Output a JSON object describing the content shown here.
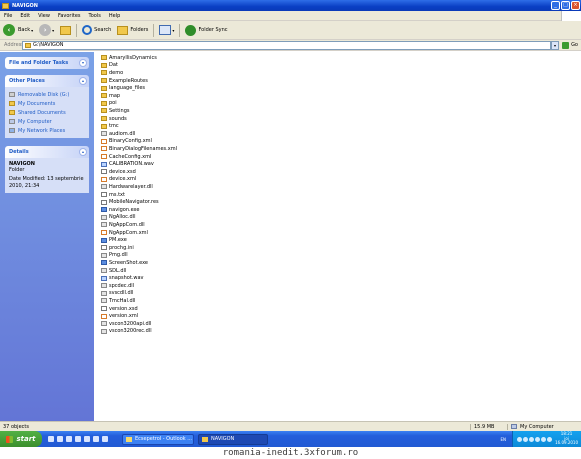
{
  "window": {
    "title": "NAVIGON"
  },
  "menu": [
    "File",
    "Edit",
    "View",
    "Favorites",
    "Tools",
    "Help"
  ],
  "toolbar": {
    "back": "Back",
    "search": "Search",
    "folders": "Folders",
    "folder_sync": "Folder Sync"
  },
  "address": {
    "label": "Address",
    "value": "G:\\NAVIGON",
    "go": "Go"
  },
  "tasks": {
    "file_folder": {
      "title": "File and Folder Tasks"
    },
    "other_places": {
      "title": "Other Places",
      "items": [
        "Removable Disk (G:)",
        "My Documents",
        "Shared Documents",
        "My Computer",
        "My Network Places"
      ]
    },
    "details": {
      "title": "Details",
      "name": "NAVIGON",
      "type": "Folder",
      "modified": "Date Modified: 13 septembrie 2010, 21:34"
    }
  },
  "files": [
    {
      "name": "AmaryllisDynamics",
      "kind": "folder"
    },
    {
      "name": "Dat",
      "kind": "folder"
    },
    {
      "name": "demo",
      "kind": "folder"
    },
    {
      "name": "ExampleRoutes",
      "kind": "folder"
    },
    {
      "name": "language_files",
      "kind": "folder"
    },
    {
      "name": "map",
      "kind": "folder"
    },
    {
      "name": "poi",
      "kind": "folder"
    },
    {
      "name": "Settings",
      "kind": "folder"
    },
    {
      "name": "sounds",
      "kind": "folder"
    },
    {
      "name": "tmc",
      "kind": "folder"
    },
    {
      "name": "audiom.dll",
      "kind": "dll"
    },
    {
      "name": "BinaryConfig.xml",
      "kind": "xml"
    },
    {
      "name": "BinaryDialogFilenames.xml",
      "kind": "xml"
    },
    {
      "name": "CacheConfig.xml",
      "kind": "xml"
    },
    {
      "name": "CALIBRATION.wav",
      "kind": "wav"
    },
    {
      "name": "device.xsd",
      "kind": "txt"
    },
    {
      "name": "device.xml",
      "kind": "xml"
    },
    {
      "name": "Hardwarelayer.dll",
      "kind": "dll"
    },
    {
      "name": "ms.txt",
      "kind": "txt"
    },
    {
      "name": "MobileNavigator.res",
      "kind": "txt"
    },
    {
      "name": "navigon.exe",
      "kind": "exe"
    },
    {
      "name": "NgAlloc.dll",
      "kind": "dll"
    },
    {
      "name": "NgAppCom.dll",
      "kind": "dll"
    },
    {
      "name": "NgAppCom.xml",
      "kind": "xml"
    },
    {
      "name": "PM.exe",
      "kind": "exe"
    },
    {
      "name": "prochg.ini",
      "kind": "txt"
    },
    {
      "name": "Pmg.dll",
      "kind": "dll"
    },
    {
      "name": "ScreenShot.exe",
      "kind": "exe"
    },
    {
      "name": "SDL.dll",
      "kind": "dll"
    },
    {
      "name": "snapshot.wav",
      "kind": "wav"
    },
    {
      "name": "spcdec.dll",
      "kind": "dll"
    },
    {
      "name": "svscdll.dll",
      "kind": "dll"
    },
    {
      "name": "TmcHal.dll",
      "kind": "dll"
    },
    {
      "name": "version.xsd",
      "kind": "txt"
    },
    {
      "name": "version.xml",
      "kind": "xml"
    },
    {
      "name": "vscon3200api.dll",
      "kind": "dll"
    },
    {
      "name": "vscon3200rec.dll",
      "kind": "dll"
    }
  ],
  "status": {
    "objects": "37 objects",
    "size": "15.9 MB",
    "location": "My Computer"
  },
  "taskbar": {
    "start": "start",
    "tasks": [
      "Ecsepetrol - Outlook ...",
      "NAVIGON"
    ],
    "lang": "EN",
    "clock": {
      "time": "18:21",
      "day": "joi",
      "date": "16.09.2010"
    }
  },
  "watermark": "romania-inedit.3xforum.ro"
}
